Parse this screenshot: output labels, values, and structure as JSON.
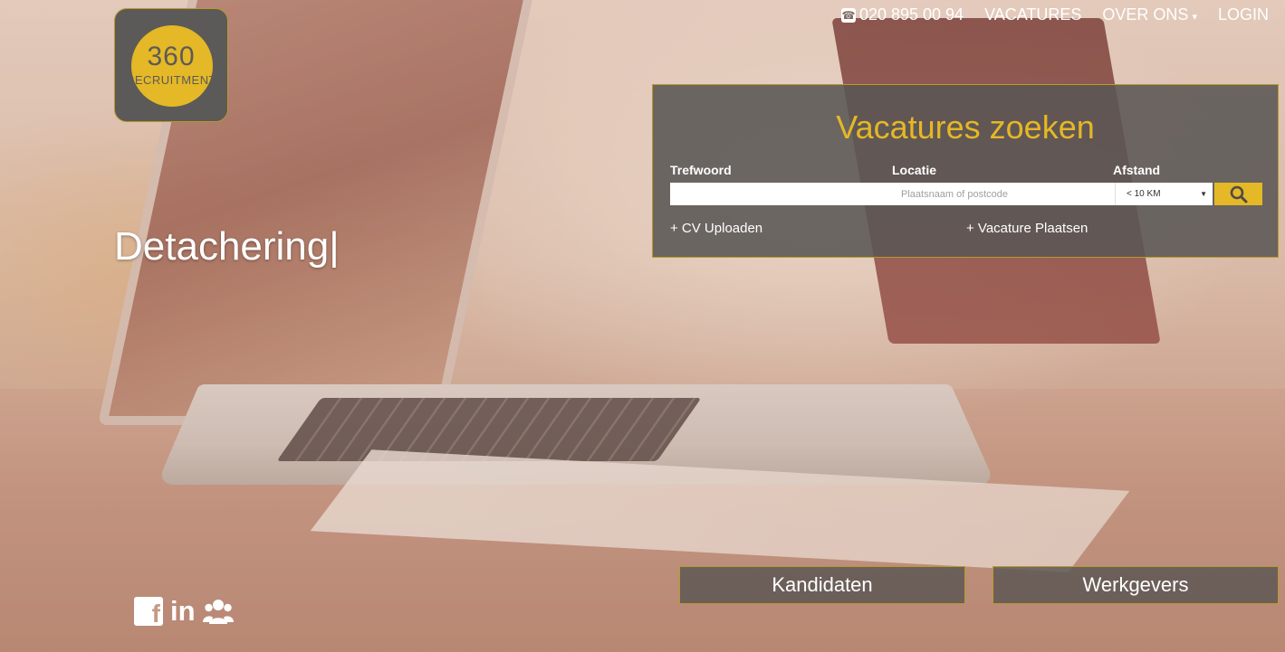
{
  "logo": {
    "number": "360",
    "word": "RECRUITMENT",
    "accent": "#e4b826",
    "bg": "#5c5a58"
  },
  "nav": {
    "phone_icon": "phone-icon",
    "phone": "020 895 00 94",
    "vacatures": "VACATURES",
    "over_ons": "OVER ONS",
    "over_ons_caret": "▾",
    "login": "LOGIN"
  },
  "hero": {
    "headline": "Detachering|"
  },
  "search": {
    "title": "Vacatures zoeken",
    "labels": {
      "keyword": "Trefwoord",
      "location": "Locatie",
      "distance": "Afstand"
    },
    "keyword_value": "",
    "location_placeholder": "Plaatsnaam of postcode",
    "distance_selected": "< 10 KM",
    "search_icon": "search-icon"
  },
  "links": {
    "cv_upload": "+ CV Uploaden",
    "place_vacancy": "+ Vacature Plaatsen"
  },
  "buttons": {
    "kandidaten": "Kandidaten",
    "werkgevers": "Werkgevers"
  },
  "social": {
    "facebook_icon": "facebook-icon",
    "facebook_letter": "f",
    "linkedin_text": "in",
    "community_icon": "group-icon"
  }
}
